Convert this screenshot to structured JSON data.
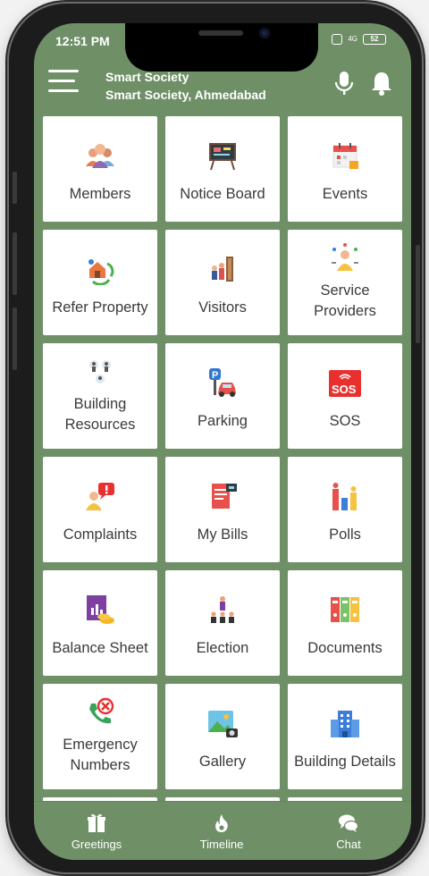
{
  "status_bar": {
    "time": "12:51 PM",
    "network": "4G",
    "battery": "52"
  },
  "header": {
    "title": "Smart Society",
    "subtitle": "Smart Society, Ahmedabad"
  },
  "tiles": [
    {
      "label": "Members",
      "icon": "members-icon"
    },
    {
      "label": "Notice Board",
      "icon": "notice-board-icon"
    },
    {
      "label": "Events",
      "icon": "events-calendar-icon"
    },
    {
      "label": "Refer Property",
      "icon": "refer-property-icon"
    },
    {
      "label": "Visitors",
      "icon": "visitors-icon"
    },
    {
      "label": "Service Providers",
      "icon": "service-providers-icon"
    },
    {
      "label": "Building Resources",
      "icon": "building-resources-icon"
    },
    {
      "label": "Parking",
      "icon": "parking-icon"
    },
    {
      "label": "SOS",
      "icon": "sos-icon"
    },
    {
      "label": "Complaints",
      "icon": "complaints-icon"
    },
    {
      "label": "My Bills",
      "icon": "bills-icon"
    },
    {
      "label": "Polls",
      "icon": "polls-icon"
    },
    {
      "label": "Balance Sheet",
      "icon": "balance-sheet-icon"
    },
    {
      "label": "Election",
      "icon": "election-icon"
    },
    {
      "label": "Documents",
      "icon": "documents-icon"
    },
    {
      "label": "Emergency Numbers",
      "icon": "emergency-numbers-icon"
    },
    {
      "label": "Gallery",
      "icon": "gallery-icon"
    },
    {
      "label": "Building Details",
      "icon": "building-details-icon"
    }
  ],
  "bottom_nav": [
    {
      "label": "Greetings",
      "icon": "greetings-icon"
    },
    {
      "label": "Timeline",
      "icon": "timeline-icon"
    },
    {
      "label": "Chat",
      "icon": "chat-icon"
    }
  ],
  "colors": {
    "primary": "#6f9067",
    "tile": "#ffffff",
    "text": "#3a3a3a"
  }
}
